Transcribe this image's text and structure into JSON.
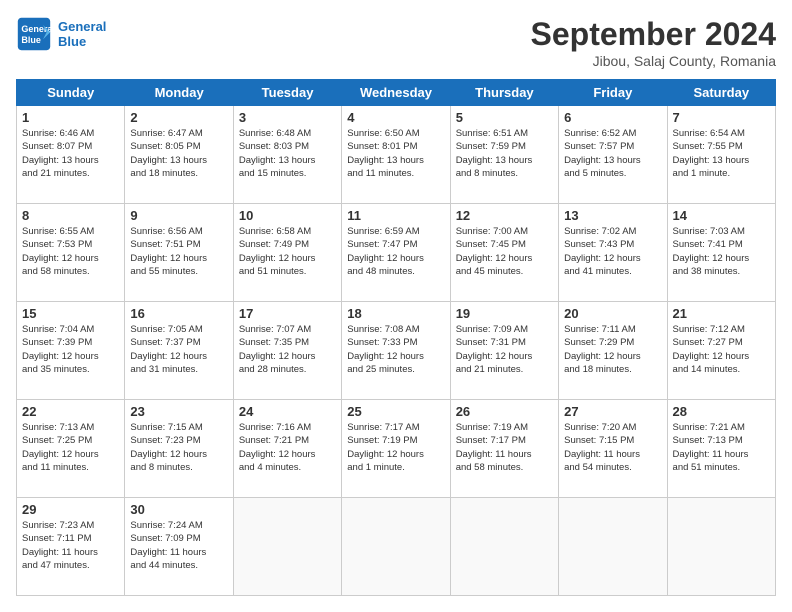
{
  "header": {
    "logo_line1": "General",
    "logo_line2": "Blue",
    "month_title": "September 2024",
    "subtitle": "Jibou, Salaj County, Romania"
  },
  "weekdays": [
    "Sunday",
    "Monday",
    "Tuesday",
    "Wednesday",
    "Thursday",
    "Friday",
    "Saturday"
  ],
  "weeks": [
    [
      {
        "day": "1",
        "info": "Sunrise: 6:46 AM\nSunset: 8:07 PM\nDaylight: 13 hours\nand 21 minutes."
      },
      {
        "day": "2",
        "info": "Sunrise: 6:47 AM\nSunset: 8:05 PM\nDaylight: 13 hours\nand 18 minutes."
      },
      {
        "day": "3",
        "info": "Sunrise: 6:48 AM\nSunset: 8:03 PM\nDaylight: 13 hours\nand 15 minutes."
      },
      {
        "day": "4",
        "info": "Sunrise: 6:50 AM\nSunset: 8:01 PM\nDaylight: 13 hours\nand 11 minutes."
      },
      {
        "day": "5",
        "info": "Sunrise: 6:51 AM\nSunset: 7:59 PM\nDaylight: 13 hours\nand 8 minutes."
      },
      {
        "day": "6",
        "info": "Sunrise: 6:52 AM\nSunset: 7:57 PM\nDaylight: 13 hours\nand 5 minutes."
      },
      {
        "day": "7",
        "info": "Sunrise: 6:54 AM\nSunset: 7:55 PM\nDaylight: 13 hours\nand 1 minute."
      }
    ],
    [
      {
        "day": "8",
        "info": "Sunrise: 6:55 AM\nSunset: 7:53 PM\nDaylight: 12 hours\nand 58 minutes."
      },
      {
        "day": "9",
        "info": "Sunrise: 6:56 AM\nSunset: 7:51 PM\nDaylight: 12 hours\nand 55 minutes."
      },
      {
        "day": "10",
        "info": "Sunrise: 6:58 AM\nSunset: 7:49 PM\nDaylight: 12 hours\nand 51 minutes."
      },
      {
        "day": "11",
        "info": "Sunrise: 6:59 AM\nSunset: 7:47 PM\nDaylight: 12 hours\nand 48 minutes."
      },
      {
        "day": "12",
        "info": "Sunrise: 7:00 AM\nSunset: 7:45 PM\nDaylight: 12 hours\nand 45 minutes."
      },
      {
        "day": "13",
        "info": "Sunrise: 7:02 AM\nSunset: 7:43 PM\nDaylight: 12 hours\nand 41 minutes."
      },
      {
        "day": "14",
        "info": "Sunrise: 7:03 AM\nSunset: 7:41 PM\nDaylight: 12 hours\nand 38 minutes."
      }
    ],
    [
      {
        "day": "15",
        "info": "Sunrise: 7:04 AM\nSunset: 7:39 PM\nDaylight: 12 hours\nand 35 minutes."
      },
      {
        "day": "16",
        "info": "Sunrise: 7:05 AM\nSunset: 7:37 PM\nDaylight: 12 hours\nand 31 minutes."
      },
      {
        "day": "17",
        "info": "Sunrise: 7:07 AM\nSunset: 7:35 PM\nDaylight: 12 hours\nand 28 minutes."
      },
      {
        "day": "18",
        "info": "Sunrise: 7:08 AM\nSunset: 7:33 PM\nDaylight: 12 hours\nand 25 minutes."
      },
      {
        "day": "19",
        "info": "Sunrise: 7:09 AM\nSunset: 7:31 PM\nDaylight: 12 hours\nand 21 minutes."
      },
      {
        "day": "20",
        "info": "Sunrise: 7:11 AM\nSunset: 7:29 PM\nDaylight: 12 hours\nand 18 minutes."
      },
      {
        "day": "21",
        "info": "Sunrise: 7:12 AM\nSunset: 7:27 PM\nDaylight: 12 hours\nand 14 minutes."
      }
    ],
    [
      {
        "day": "22",
        "info": "Sunrise: 7:13 AM\nSunset: 7:25 PM\nDaylight: 12 hours\nand 11 minutes."
      },
      {
        "day": "23",
        "info": "Sunrise: 7:15 AM\nSunset: 7:23 PM\nDaylight: 12 hours\nand 8 minutes."
      },
      {
        "day": "24",
        "info": "Sunrise: 7:16 AM\nSunset: 7:21 PM\nDaylight: 12 hours\nand 4 minutes."
      },
      {
        "day": "25",
        "info": "Sunrise: 7:17 AM\nSunset: 7:19 PM\nDaylight: 12 hours\nand 1 minute."
      },
      {
        "day": "26",
        "info": "Sunrise: 7:19 AM\nSunset: 7:17 PM\nDaylight: 11 hours\nand 58 minutes."
      },
      {
        "day": "27",
        "info": "Sunrise: 7:20 AM\nSunset: 7:15 PM\nDaylight: 11 hours\nand 54 minutes."
      },
      {
        "day": "28",
        "info": "Sunrise: 7:21 AM\nSunset: 7:13 PM\nDaylight: 11 hours\nand 51 minutes."
      }
    ],
    [
      {
        "day": "29",
        "info": "Sunrise: 7:23 AM\nSunset: 7:11 PM\nDaylight: 11 hours\nand 47 minutes."
      },
      {
        "day": "30",
        "info": "Sunrise: 7:24 AM\nSunset: 7:09 PM\nDaylight: 11 hours\nand 44 minutes."
      },
      {
        "day": "",
        "info": ""
      },
      {
        "day": "",
        "info": ""
      },
      {
        "day": "",
        "info": ""
      },
      {
        "day": "",
        "info": ""
      },
      {
        "day": "",
        "info": ""
      }
    ]
  ]
}
